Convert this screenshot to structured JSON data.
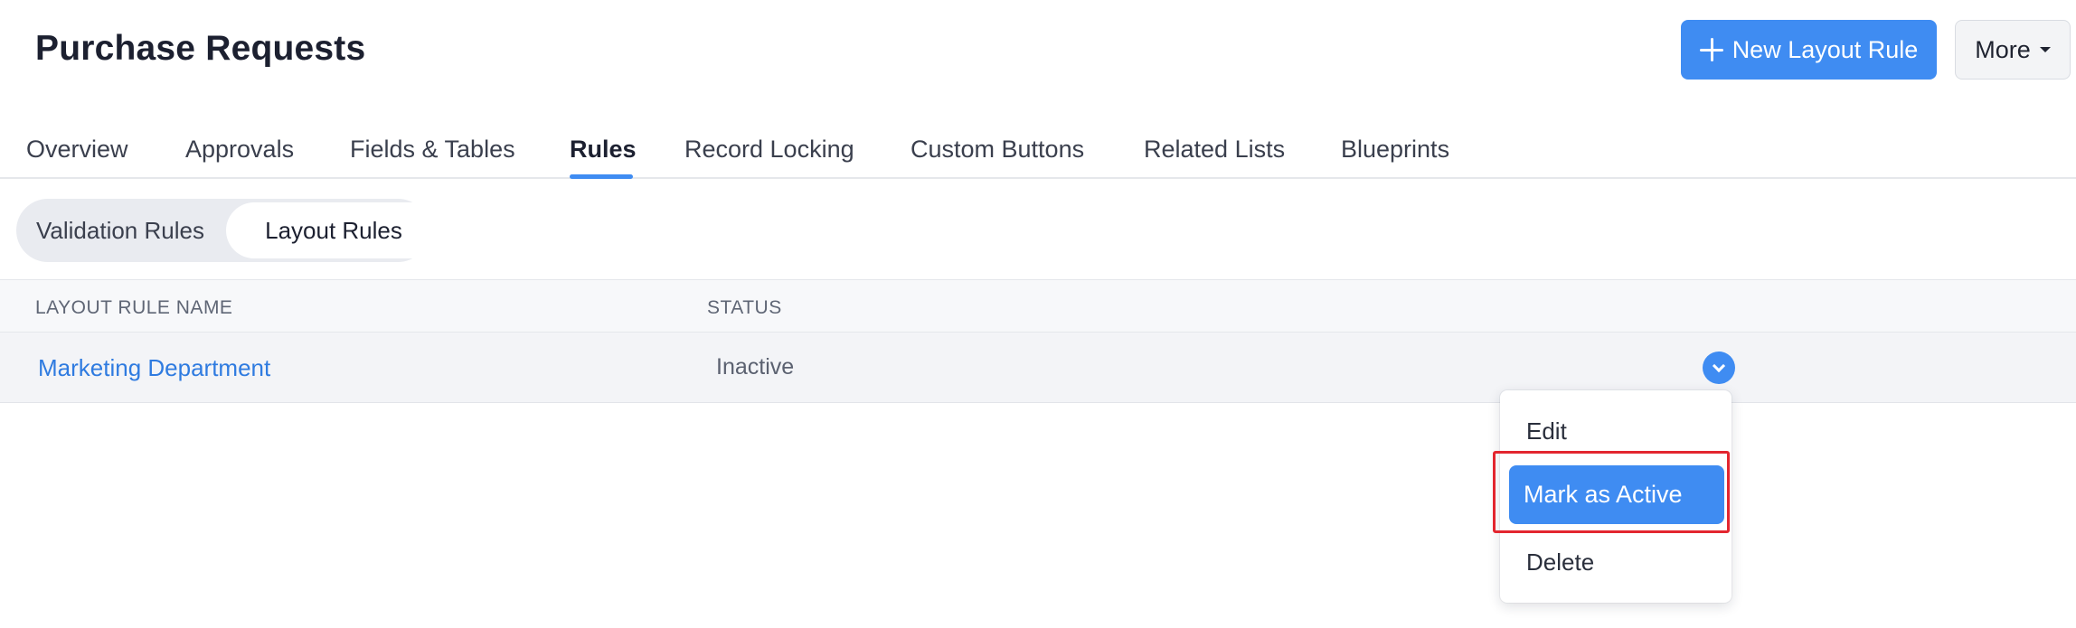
{
  "header": {
    "title": "Purchase Requests",
    "new_button_label": "New Layout Rule",
    "more_button_label": "More"
  },
  "tabs": [
    {
      "label": "Overview"
    },
    {
      "label": "Approvals"
    },
    {
      "label": "Fields & Tables"
    },
    {
      "label": "Rules",
      "active": true
    },
    {
      "label": "Record Locking"
    },
    {
      "label": "Custom Buttons"
    },
    {
      "label": "Related Lists"
    },
    {
      "label": "Blueprints"
    }
  ],
  "segment": {
    "items": [
      {
        "label": "Validation Rules"
      },
      {
        "label": "Layout Rules",
        "selected": true
      }
    ]
  },
  "table": {
    "columns": [
      "LAYOUT RULE NAME",
      "STATUS"
    ],
    "rows": [
      {
        "name": "Marketing Department",
        "status": "Inactive"
      }
    ]
  },
  "row_menu": {
    "items": [
      {
        "label": "Edit"
      },
      {
        "label": "Mark as Active",
        "highlighted": true
      },
      {
        "label": "Delete"
      }
    ]
  },
  "colors": {
    "accent": "#3f8cf2",
    "link": "#2f7be0",
    "highlight_border": "#e3262f"
  }
}
